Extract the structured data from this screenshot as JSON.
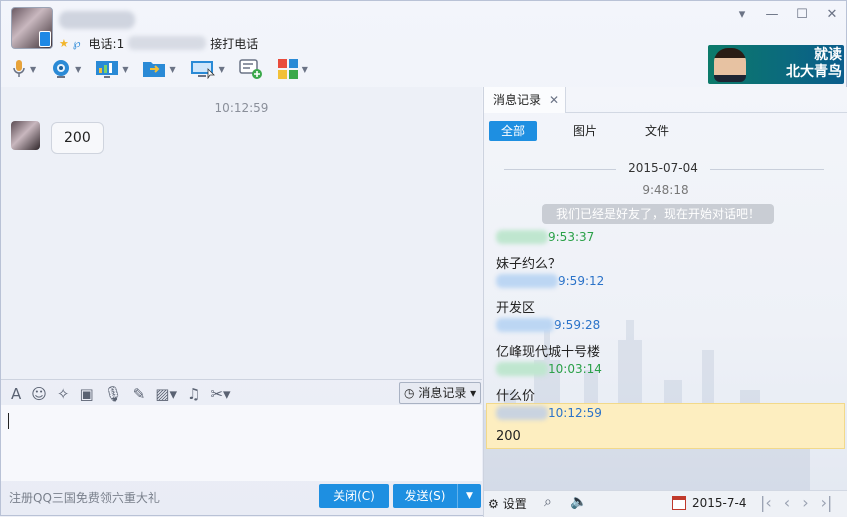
{
  "header": {
    "phone_label": "电话:1",
    "phone_suffix": "接打电话",
    "ad_line1": "就读",
    "ad_line2": "北大青鸟"
  },
  "chat": {
    "time": "10:12:59",
    "message": "200"
  },
  "input_toolbar": {
    "history_button": "消息记录"
  },
  "footer": {
    "promo": "注册QQ三国免费领六重大礼",
    "close_button": "关闭(C)",
    "send_button": "发送(S)"
  },
  "history": {
    "tab_title": "消息记录",
    "filters": [
      "全部",
      "图片",
      "文件"
    ],
    "date": "2015-07-04",
    "system_time": "9:48:18",
    "system_message": "我们已经是好友了，现在开始对话吧！",
    "entries": [
      {
        "time": "9:53:37",
        "text": "妹子约么？"
      },
      {
        "time": "9:59:12",
        "text": "开发区"
      },
      {
        "time": "9:59:28",
        "text": "亿峰现代城十号楼"
      },
      {
        "time": "10:03:14",
        "text": "什么价"
      },
      {
        "time": "10:12:59",
        "text": "200"
      }
    ]
  },
  "history_footer": {
    "settings_label": "设置",
    "date_label": "2015-7-4"
  },
  "colors": {
    "accent": "#1e8fe1",
    "highlight": "#fdeec0",
    "green_time": "#2aa048",
    "blue_time": "#2b73c9"
  }
}
